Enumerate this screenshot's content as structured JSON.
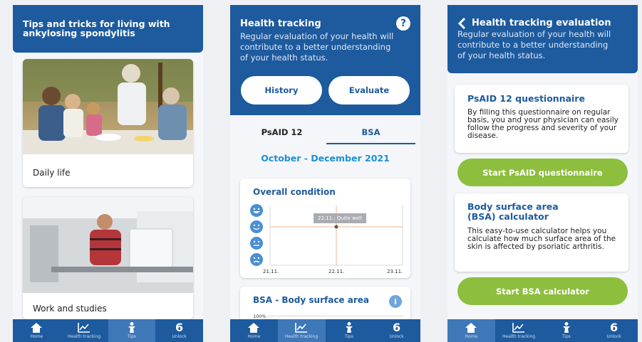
{
  "screen1": {
    "title": "Tips and tricks for living with ankylosing spondylitis",
    "cards": [
      {
        "label": "Daily life"
      },
      {
        "label": "Work and studies"
      }
    ]
  },
  "screen2": {
    "title": "Health tracking",
    "subtitle": "Regular evaluation of your health will contribute to a better understanding of your health status.",
    "history_label": "History",
    "evaluate_label": "Evaluate",
    "tabs": [
      "PsAID 12",
      "BSA"
    ],
    "active_tab": "BSA",
    "period": "October - December 2021",
    "overall": {
      "title": "Overall condition",
      "tooltip": "22.11.: Quite well",
      "x_ticks": [
        "21.11.",
        "22.11.",
        "23.11."
      ]
    },
    "bsa": {
      "title": "BSA - Body surface area",
      "y_top": "100%"
    }
  },
  "screen3": {
    "title": "Health tracking evaluation",
    "subtitle": "Regular evaluation of your health will contribute to a better understanding of your health status.",
    "psaid": {
      "title": "PsAID 12 questionnaire",
      "body": "By filling this questionnaire on regular basis, you and your physician can easily follow the progress and severity of your disease.",
      "button": "Start PsAID questionnaire"
    },
    "bsa": {
      "title": "Body surface area (BSA) calculator",
      "body": "This easy-to-use calculator helps you calculate how much surface area of the skin is affected by psoriatic arthritis.",
      "button": "Start BSA calculator"
    }
  },
  "nav": {
    "items": [
      {
        "label": "Home",
        "icon": "home-icon"
      },
      {
        "label": "Health tracking",
        "icon": "chart-icon"
      },
      {
        "label": "Tips",
        "icon": "person-icon"
      },
      {
        "label": "Unlock",
        "icon": "six-icon"
      }
    ],
    "unlock_glyph": "6"
  },
  "colors": {
    "primary": "#1d5a9e",
    "accent_green": "#8dbe3d",
    "accent_blue": "#1e8fd6",
    "tooltip": "#a9acb0"
  }
}
